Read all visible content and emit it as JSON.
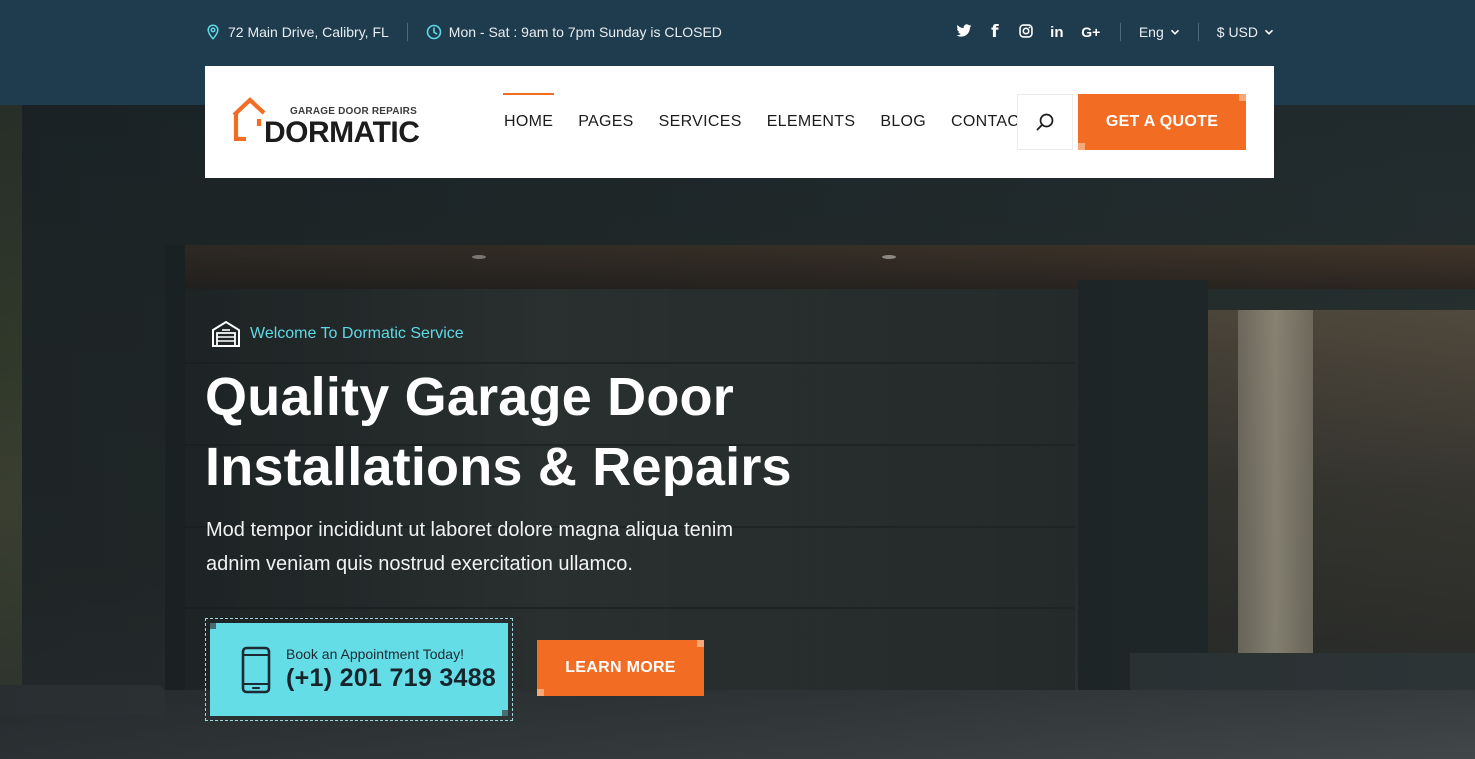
{
  "topbar": {
    "address": "72 Main Drive, Calibry, FL",
    "hours": "Mon - Sat : 9am to 7pm Sunday is CLOSED",
    "social": {
      "twitter": "𝕥",
      "facebook": "f",
      "instagram": "◎",
      "linkedin": "in",
      "googleplus": "G+"
    },
    "language": "Eng",
    "currency": "$ USD"
  },
  "header": {
    "logo_tagline": "GARAGE DOOR REPAIRS",
    "logo_brand": "DORMATIC",
    "nav": [
      "HOME",
      "PAGES",
      "SERVICES",
      "ELEMENTS",
      "BLOG",
      "CONTACT"
    ],
    "active_nav": "HOME",
    "quote_button": "GET A QUOTE"
  },
  "hero": {
    "welcome": "Welcome To Dormatic Service",
    "headline_line1": "Quality Garage Door",
    "headline_line2": "Installations & Repairs",
    "sub_line1": "Mod tempor incididunt ut laboret dolore magna aliqua tenim",
    "sub_line2": "adnim veniam quis nostrud exercitation ullamco.",
    "appointment_label": "Book an Appointment Today!",
    "appointment_phone": "(+1) 201 719 3488",
    "learn_more": "LEARN MORE"
  },
  "colors": {
    "accent": "#f36c23",
    "cyan": "#64dde7",
    "topbar": "#1f3b4e"
  }
}
